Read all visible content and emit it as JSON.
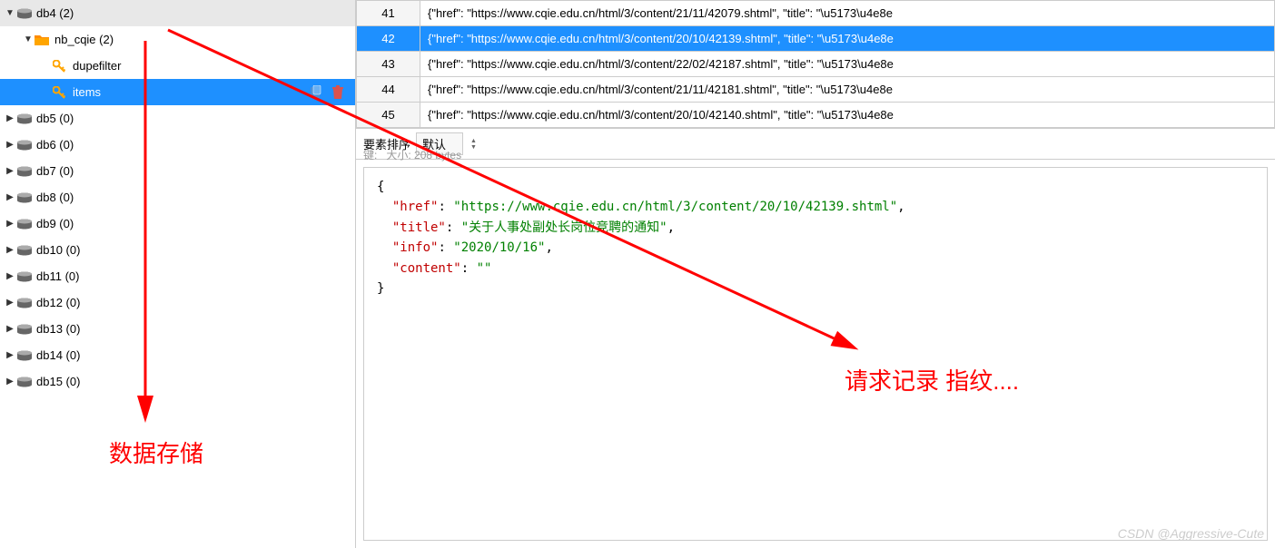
{
  "sidebar": {
    "items": [
      {
        "name": "db4",
        "count": "(2)",
        "type": "db",
        "expanded": true,
        "level": 0
      },
      {
        "name": "nb_cqie",
        "count": "(2)",
        "type": "folder",
        "expanded": true,
        "level": 1
      },
      {
        "name": "dupefilter",
        "type": "key",
        "level": 2
      },
      {
        "name": "items",
        "type": "key",
        "level": 2,
        "selected": true,
        "actions": true
      },
      {
        "name": "db5",
        "count": "(0)",
        "type": "db",
        "level": 0
      },
      {
        "name": "db6",
        "count": "(0)",
        "type": "db",
        "level": 0
      },
      {
        "name": "db7",
        "count": "(0)",
        "type": "db",
        "level": 0
      },
      {
        "name": "db8",
        "count": "(0)",
        "type": "db",
        "level": 0
      },
      {
        "name": "db9",
        "count": "(0)",
        "type": "db",
        "level": 0
      },
      {
        "name": "db10",
        "count": "(0)",
        "type": "db",
        "level": 0
      },
      {
        "name": "db11",
        "count": "(0)",
        "type": "db",
        "level": 0
      },
      {
        "name": "db12",
        "count": "(0)",
        "type": "db",
        "level": 0
      },
      {
        "name": "db13",
        "count": "(0)",
        "type": "db",
        "level": 0
      },
      {
        "name": "db14",
        "count": "(0)",
        "type": "db",
        "level": 0
      },
      {
        "name": "db15",
        "count": "(0)",
        "type": "db",
        "level": 0
      }
    ]
  },
  "table": {
    "rows": [
      {
        "num": "41",
        "value": "{\"href\": \"https://www.cqie.edu.cn/html/3/content/21/11/42079.shtml\", \"title\": \"\\u5173\\u4e8e"
      },
      {
        "num": "42",
        "value": "{\"href\": \"https://www.cqie.edu.cn/html/3/content/20/10/42139.shtml\", \"title\": \"\\u5173\\u4e8e",
        "selected": true
      },
      {
        "num": "43",
        "value": "{\"href\": \"https://www.cqie.edu.cn/html/3/content/22/02/42187.shtml\", \"title\": \"\\u5173\\u4e8e"
      },
      {
        "num": "44",
        "value": "{\"href\": \"https://www.cqie.edu.cn/html/3/content/21/11/42181.shtml\", \"title\": \"\\u5173\\u4e8e"
      },
      {
        "num": "45",
        "value": "{\"href\": \"https://www.cqie.edu.cn/html/3/content/20/10/42140.shtml\", \"title\": \"\\u5173\\u4e8e"
      }
    ]
  },
  "middle": {
    "sort_label": "要素排序",
    "sort_value": "默认",
    "key_label": "键",
    "size_label": "大小",
    "size_value": "208 bytes"
  },
  "json": {
    "href_key": "\"href\"",
    "href_val": "\"https://www.cqie.edu.cn/html/3/content/20/10/42139.shtml\"",
    "title_key": "\"title\"",
    "title_val": "\"关于人事处副处长岗位竞聘的通知\"",
    "info_key": "\"info\"",
    "info_val": "\"2020/10/16\"",
    "content_key": "\"content\"",
    "content_val": "\"\""
  },
  "annotations": {
    "left": "数据存储",
    "right": "请求记录 指纹....",
    "watermark": "CSDN @Aggressive-Cute"
  }
}
